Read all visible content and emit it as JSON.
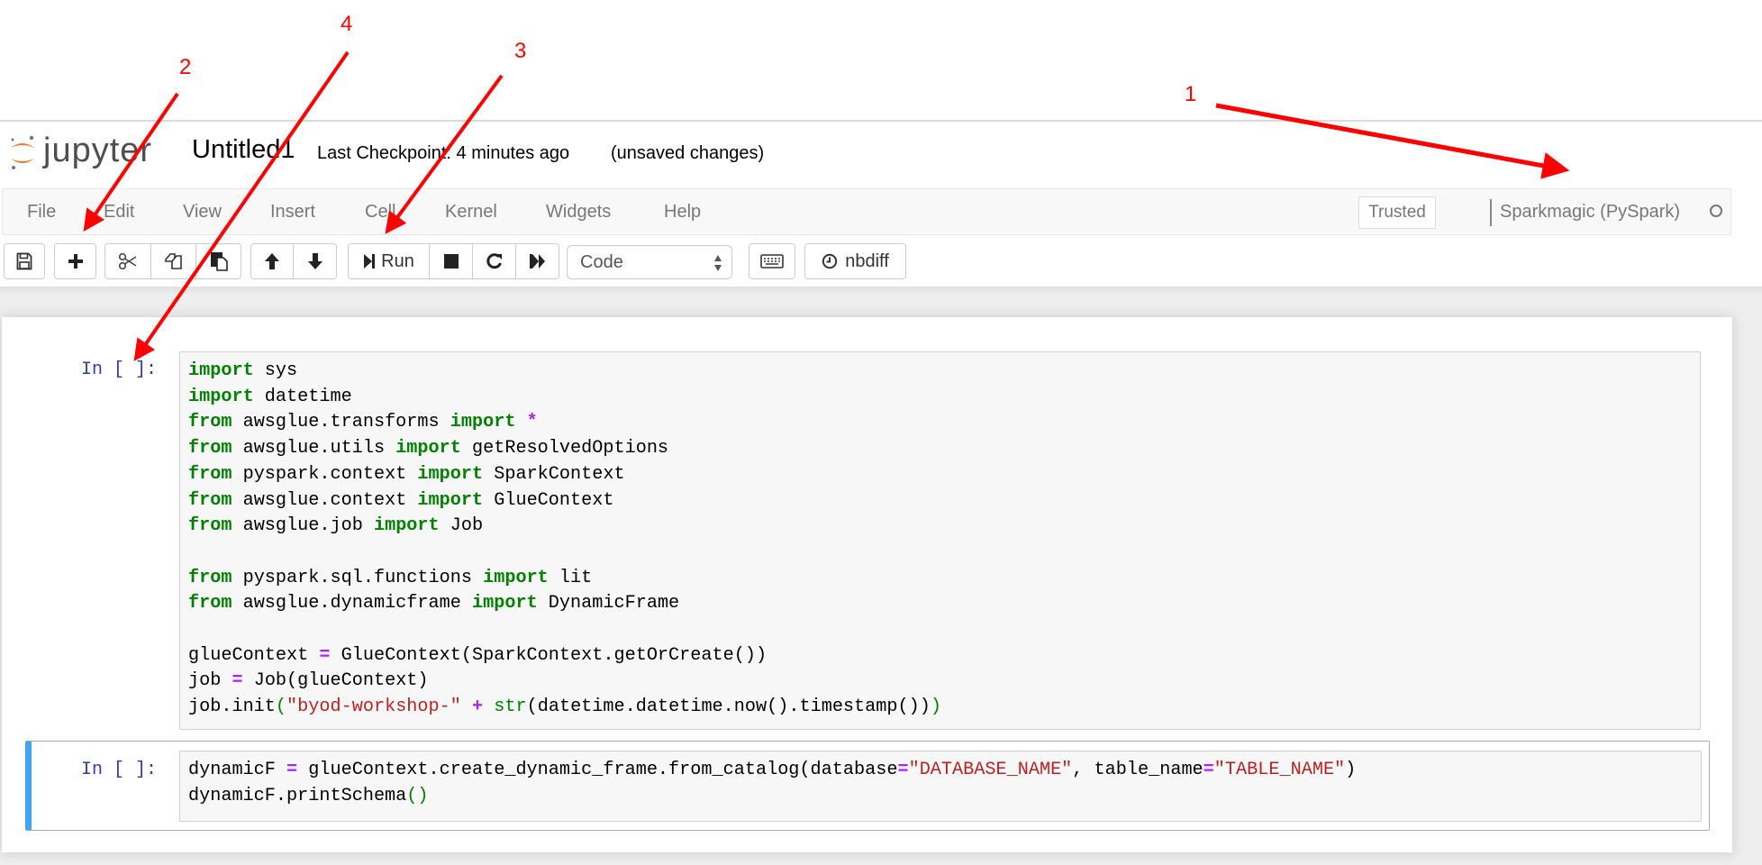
{
  "header": {
    "logo_text": "jupyter",
    "notebook_title": "Untitled1",
    "checkpoint": "Last Checkpoint: 4 minutes ago",
    "save_status": "(unsaved changes)"
  },
  "menubar": {
    "items": [
      "File",
      "Edit",
      "View",
      "Insert",
      "Cell",
      "Kernel",
      "Widgets",
      "Help"
    ],
    "trusted_label": "Trusted",
    "kernel_name": "Sparkmagic (PySpark)",
    "kernel_status": "idle"
  },
  "toolbar": {
    "buttons": [
      {
        "name": "save",
        "icon": "floppy-disk-icon"
      },
      {
        "name": "insert-cell-below",
        "icon": "plus-icon"
      },
      {
        "name": "cut",
        "icon": "scissors-icon"
      },
      {
        "name": "copy",
        "icon": "copy-icon"
      },
      {
        "name": "paste",
        "icon": "paste-icon"
      },
      {
        "name": "move-up",
        "icon": "arrow-up-icon"
      },
      {
        "name": "move-down",
        "icon": "arrow-down-icon"
      },
      {
        "name": "run",
        "icon": "step-forward-icon",
        "label": "Run"
      },
      {
        "name": "interrupt",
        "icon": "stop-icon"
      },
      {
        "name": "restart",
        "icon": "restart-icon"
      },
      {
        "name": "restart-run-all",
        "icon": "fast-forward-icon"
      },
      {
        "name": "command-palette",
        "icon": "keyboard-icon"
      },
      {
        "name": "nbdiff",
        "icon": "clock-icon",
        "label": "nbdiff"
      }
    ],
    "run_label": "Run",
    "cell_type": "Code",
    "nbdiff_label": "nbdiff"
  },
  "cells": [
    {
      "prompt": "In [ ]:",
      "selected": false,
      "lines": [
        "import sys",
        "import datetime",
        "from awsglue.transforms import *",
        "from awsglue.utils import getResolvedOptions",
        "from pyspark.context import SparkContext",
        "from awsglue.context import GlueContext",
        "from awsglue.job import Job",
        "",
        "from pyspark.sql.functions import lit",
        "from awsglue.dynamicframe import DynamicFrame",
        "",
        "glueContext = GlueContext(SparkContext.getOrCreate())",
        "job = Job(glueContext)",
        "job.init(\"byod-workshop-\" + str(datetime.datetime.now().timestamp()))"
      ]
    },
    {
      "prompt": "In [ ]:",
      "selected": true,
      "lines": [
        "dynamicF = glueContext.create_dynamic_frame.from_catalog(database=\"DATABASE_NAME\", table_name=\"TABLE_NAME\")",
        "dynamicF.printSchema()"
      ]
    }
  ],
  "annotations": [
    {
      "label": "1",
      "target": "kernel indicator"
    },
    {
      "label": "2",
      "target": "insert cell button"
    },
    {
      "label": "3",
      "target": "run button"
    },
    {
      "label": "4",
      "target": "cell prompt"
    }
  ],
  "colors": {
    "annotation": "#ff0000",
    "selected_cell_bar": "#42a5f5",
    "keyword": "#008000",
    "operator": "#aa22ff",
    "string": "#ba2121",
    "prompt": "#303f9f"
  }
}
